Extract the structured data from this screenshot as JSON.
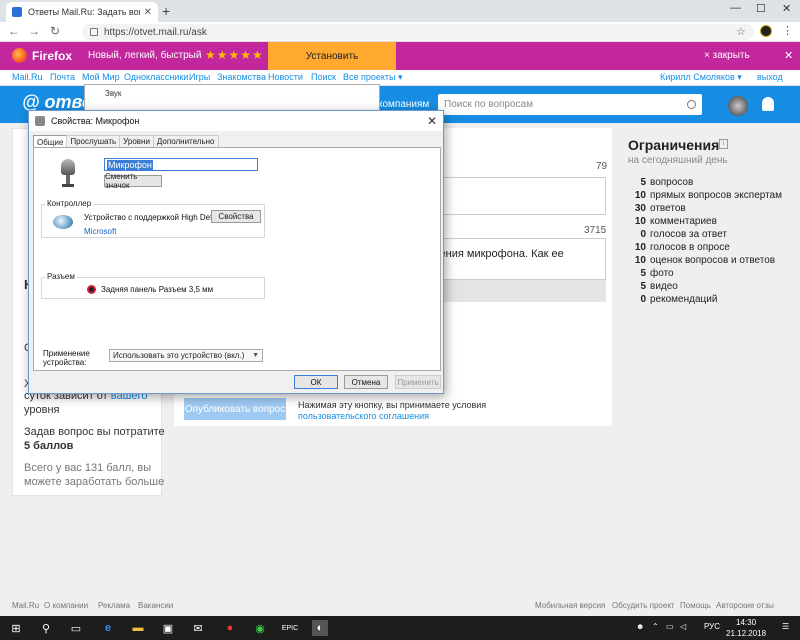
{
  "browser": {
    "tab_title": "Ответы Mail.Ru: Задать вопрос",
    "tab_close": "✕",
    "new_tab": "+",
    "url": "https://otvet.mail.ru/ask",
    "win_min": "—",
    "win_max": "☐",
    "win_close": "✕"
  },
  "promo": {
    "brand": "Firefox",
    "text": "Новый, легкий, быстрый",
    "stars": "★★★★★",
    "install": "Установить",
    "close": "× закрыть",
    "x": "✕"
  },
  "portal": {
    "links": [
      "Mail.Ru",
      "Почта",
      "Мой Мир",
      "Одноклассники",
      "Игры",
      "Знакомства",
      "Новости",
      "Поиск",
      "Все проекты ▾"
    ],
    "user": "Кирилл Смоляков ▾",
    "exit": "выход"
  },
  "header": {
    "logo": "@ ответ",
    "link": "компаниям",
    "search_placeholder": "Поиск по вопросам"
  },
  "left": {
    "letter1": "Н",
    "letter2": "С",
    "letter3": "Х",
    "line1": "суток зависит от",
    "line1_link": "вашего",
    "line2_link": "уровня",
    "cost_line": "Задав вопрос вы потратите",
    "cost_value": "5 баллов",
    "total_line1": "Всего у вас 131 балл, вы",
    "total_line2": "можете заработать больше"
  },
  "main": {
    "count_title": "79",
    "count_text": "3715",
    "text_fragment_1": "иления микрофона. Как ее",
    "text_fragment_2": "",
    "publish": "Опубликовать вопрос",
    "agree_line": "Нажимая эту кнопку, вы принимаете условия",
    "agree_link": "пользовательского соглашения"
  },
  "limits": {
    "title": "Ограничения",
    "info": "i",
    "subtitle": "на сегодняшний день",
    "rows": [
      {
        "n": "5",
        "label": "вопросов"
      },
      {
        "n": "10",
        "label": "прямых вопросов экспертам"
      },
      {
        "n": "30",
        "label": "ответов"
      },
      {
        "n": "10",
        "label": "комментариев"
      },
      {
        "n": "0",
        "label": "голосов за ответ"
      },
      {
        "n": "10",
        "label": "голосов в опросе"
      },
      {
        "n": "10",
        "label": "оценок вопросов и ответов"
      },
      {
        "n": "5",
        "label": "фото"
      },
      {
        "n": "5",
        "label": "видео"
      },
      {
        "n": "0",
        "label": "рекомендаций"
      }
    ]
  },
  "sound_dialog": {
    "title": "Звук"
  },
  "dialog": {
    "title": "Свойства: Микрофон",
    "close": "✕",
    "tabs": [
      "Общие",
      "Прослушать",
      "Уровни",
      "Дополнительно"
    ],
    "device_name": "Микрофон",
    "change_icon": "Сменить значок",
    "controller_label": "Контроллер",
    "controller_name": "Устройство с поддержкой High Defi...",
    "controller_mfr": "Microsoft",
    "properties": "Свойства",
    "jack_label": "Разъем",
    "jack_name": "Задняя панель Разъем 3,5 мм",
    "usage_label_1": "Применение",
    "usage_label_2": "устройства:",
    "usage_value": "Использовать это устройство (вкл.)",
    "ok": "ОК",
    "cancel": "Отмена",
    "apply": "Применить"
  },
  "footer": {
    "left": [
      "Mail.Ru",
      "О компании",
      "Реклама",
      "Вакансии"
    ],
    "right": [
      "Мобильная версия",
      "Обсудить проект",
      "Помощь",
      "Авторские отзы"
    ]
  },
  "taskbar": {
    "lang": "РУС",
    "time": "14:30",
    "date": "21.12.2018"
  }
}
